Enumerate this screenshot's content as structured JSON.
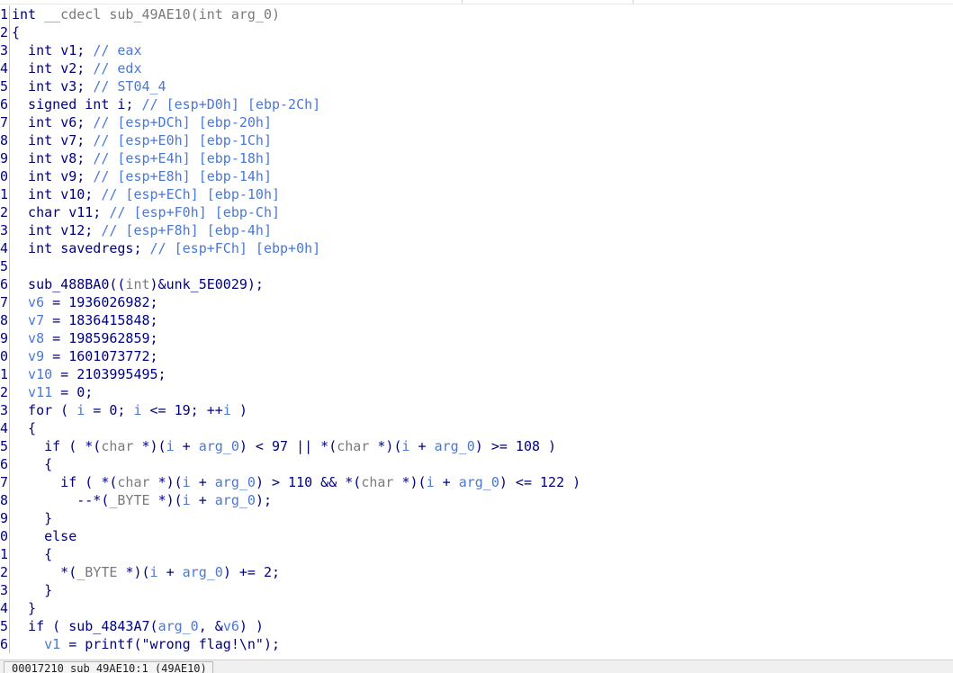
{
  "lines": [
    {
      "n": "1",
      "segs": [
        [
          "k",
          "int "
        ],
        [
          "t",
          "__cdecl "
        ],
        [
          "t",
          "sub_49AE10(int arg_0)"
        ]
      ]
    },
    {
      "n": "2",
      "segs": [
        [
          "p",
          "{"
        ]
      ]
    },
    {
      "n": "3",
      "segs": [
        [
          "k",
          "  int "
        ],
        [
          "p",
          "v1; "
        ],
        [
          "c",
          "// eax"
        ]
      ]
    },
    {
      "n": "4",
      "segs": [
        [
          "k",
          "  int "
        ],
        [
          "p",
          "v2; "
        ],
        [
          "c",
          "// edx"
        ]
      ]
    },
    {
      "n": "5",
      "segs": [
        [
          "k",
          "  int "
        ],
        [
          "p",
          "v3; "
        ],
        [
          "c",
          "// ST04_4"
        ]
      ]
    },
    {
      "n": "6",
      "segs": [
        [
          "k",
          "  signed int "
        ],
        [
          "p",
          "i; "
        ],
        [
          "c",
          "// [esp+D0h] [ebp-2Ch]"
        ]
      ]
    },
    {
      "n": "7",
      "segs": [
        [
          "k",
          "  int "
        ],
        [
          "p",
          "v6; "
        ],
        [
          "c",
          "// [esp+DCh] [ebp-20h]"
        ]
      ]
    },
    {
      "n": "8",
      "segs": [
        [
          "k",
          "  int "
        ],
        [
          "p",
          "v7; "
        ],
        [
          "c",
          "// [esp+E0h] [ebp-1Ch]"
        ]
      ]
    },
    {
      "n": "9",
      "segs": [
        [
          "k",
          "  int "
        ],
        [
          "p",
          "v8; "
        ],
        [
          "c",
          "// [esp+E4h] [ebp-18h]"
        ]
      ]
    },
    {
      "n": "0",
      "segs": [
        [
          "k",
          "  int "
        ],
        [
          "p",
          "v9; "
        ],
        [
          "c",
          "// [esp+E8h] [ebp-14h]"
        ]
      ]
    },
    {
      "n": "1",
      "segs": [
        [
          "k",
          "  int "
        ],
        [
          "p",
          "v10; "
        ],
        [
          "c",
          "// [esp+ECh] [ebp-10h]"
        ]
      ]
    },
    {
      "n": "2",
      "segs": [
        [
          "k",
          "  char "
        ],
        [
          "p",
          "v11; "
        ],
        [
          "c",
          "// [esp+F0h] [ebp-Ch]"
        ]
      ]
    },
    {
      "n": "3",
      "segs": [
        [
          "k",
          "  int "
        ],
        [
          "p",
          "v12; "
        ],
        [
          "c",
          "// [esp+F8h] [ebp-4h]"
        ]
      ]
    },
    {
      "n": "4",
      "segs": [
        [
          "k",
          "  int "
        ],
        [
          "p",
          "savedregs; "
        ],
        [
          "c",
          "// [esp+FCh] [ebp+0h]"
        ]
      ]
    },
    {
      "n": "5",
      "segs": []
    },
    {
      "n": "6",
      "segs": [
        [
          "p",
          "  sub_488BA0(("
        ],
        [
          "t",
          "int"
        ],
        [
          "p",
          ")&unk_5E0029);"
        ]
      ]
    },
    {
      "n": "7",
      "segs": [
        [
          "v",
          "  v6"
        ],
        [
          "p",
          " = 1936026982;"
        ]
      ]
    },
    {
      "n": "8",
      "segs": [
        [
          "v",
          "  v7"
        ],
        [
          "p",
          " = 1836415848;"
        ]
      ]
    },
    {
      "n": "9",
      "segs": [
        [
          "v",
          "  v8"
        ],
        [
          "p",
          " = 1985962859;"
        ]
      ]
    },
    {
      "n": "0",
      "segs": [
        [
          "v",
          "  v9"
        ],
        [
          "p",
          " = 1601073772;"
        ]
      ]
    },
    {
      "n": "1",
      "segs": [
        [
          "v",
          "  v10"
        ],
        [
          "p",
          " = 2103995495;"
        ]
      ]
    },
    {
      "n": "2",
      "segs": [
        [
          "v",
          "  v11"
        ],
        [
          "p",
          " = 0;"
        ]
      ]
    },
    {
      "n": "3",
      "segs": [
        [
          "p",
          "  for ( "
        ],
        [
          "v",
          "i"
        ],
        [
          "p",
          " = 0; "
        ],
        [
          "v",
          "i"
        ],
        [
          "p",
          " <= 19; ++"
        ],
        [
          "v",
          "i"
        ],
        [
          "p",
          " )"
        ]
      ]
    },
    {
      "n": "4",
      "segs": [
        [
          "p",
          "  {"
        ]
      ]
    },
    {
      "n": "5",
      "segs": [
        [
          "p",
          "    if ( *("
        ],
        [
          "t",
          "char "
        ],
        [
          "p",
          "*)("
        ],
        [
          "v",
          "i"
        ],
        [
          "p",
          " + "
        ],
        [
          "v",
          "arg_0"
        ],
        [
          "p",
          ") < 97 || *("
        ],
        [
          "t",
          "char "
        ],
        [
          "p",
          "*)("
        ],
        [
          "v",
          "i"
        ],
        [
          "p",
          " + "
        ],
        [
          "v",
          "arg_0"
        ],
        [
          "p",
          ") >= 108 )"
        ]
      ]
    },
    {
      "n": "6",
      "segs": [
        [
          "p",
          "    {"
        ]
      ]
    },
    {
      "n": "7",
      "segs": [
        [
          "p",
          "      if ( *("
        ],
        [
          "t",
          "char "
        ],
        [
          "p",
          "*)("
        ],
        [
          "v",
          "i"
        ],
        [
          "p",
          " + "
        ],
        [
          "v",
          "arg_0"
        ],
        [
          "p",
          ") > 110 && *("
        ],
        [
          "t",
          "char "
        ],
        [
          "p",
          "*)("
        ],
        [
          "v",
          "i"
        ],
        [
          "p",
          " + "
        ],
        [
          "v",
          "arg_0"
        ],
        [
          "p",
          ") <= 122 )"
        ]
      ]
    },
    {
      "n": "8",
      "segs": [
        [
          "p",
          "        --*("
        ],
        [
          "t",
          "_BYTE "
        ],
        [
          "p",
          "*)("
        ],
        [
          "v",
          "i"
        ],
        [
          "p",
          " + "
        ],
        [
          "v",
          "arg_0"
        ],
        [
          "p",
          ");"
        ]
      ]
    },
    {
      "n": "9",
      "segs": [
        [
          "p",
          "    }"
        ]
      ]
    },
    {
      "n": "0",
      "segs": [
        [
          "p",
          "    else"
        ]
      ]
    },
    {
      "n": "1",
      "segs": [
        [
          "p",
          "    {"
        ]
      ]
    },
    {
      "n": "2",
      "segs": [
        [
          "p",
          "      *("
        ],
        [
          "t",
          "_BYTE "
        ],
        [
          "p",
          "*)("
        ],
        [
          "v",
          "i"
        ],
        [
          "p",
          " + "
        ],
        [
          "v",
          "arg_0"
        ],
        [
          "p",
          ") += 2;"
        ]
      ]
    },
    {
      "n": "3",
      "segs": [
        [
          "p",
          "    }"
        ]
      ]
    },
    {
      "n": "4",
      "segs": [
        [
          "p",
          "  }"
        ]
      ]
    },
    {
      "n": "5",
      "segs": [
        [
          "p",
          "  if ( sub_4843A7("
        ],
        [
          "v",
          "arg_0"
        ],
        [
          "p",
          ", &"
        ],
        [
          "v",
          "v6"
        ],
        [
          "p",
          ") )"
        ]
      ]
    },
    {
      "n": "6",
      "segs": [
        [
          "v",
          "    v1"
        ],
        [
          "p",
          " = printf(\"wrong flag!\\n\");"
        ]
      ]
    }
  ],
  "status": {
    "position_text": "00017210 sub_49AE10:1 (49AE10)"
  }
}
